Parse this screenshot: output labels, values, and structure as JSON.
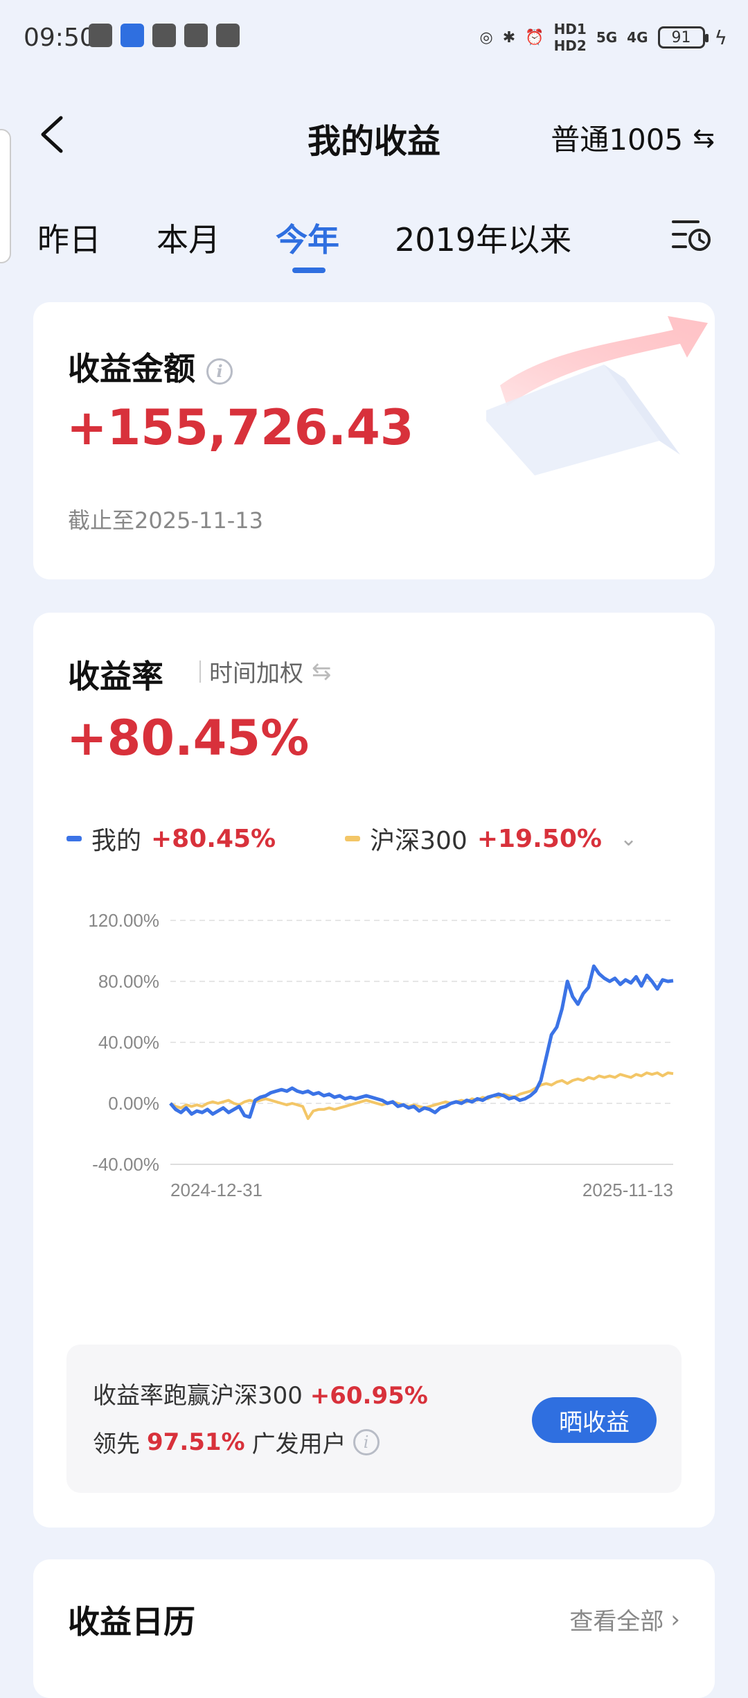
{
  "status_bar": {
    "time": "09:50",
    "hd1": "HD1",
    "hd2": "HD2",
    "net1": "5G",
    "net2": "4G",
    "battery": "91"
  },
  "header": {
    "title": "我的收益",
    "account": "普通1005"
  },
  "tabs": [
    "昨日",
    "本月",
    "今年",
    "2019年以来"
  ],
  "active_tab": "今年",
  "amount_card": {
    "title": "收益金额",
    "value": "+155,726.43",
    "as_of": "截止至2025-11-13"
  },
  "rate_card": {
    "title": "收益率",
    "mode": "时间加权",
    "value": "+80.45%",
    "legend": [
      {
        "name": "我的",
        "value": "+80.45%",
        "color": "#3b73e6"
      },
      {
        "name": "沪深300",
        "value": "+19.50%",
        "color": "#f3c667"
      }
    ]
  },
  "chart_data": {
    "type": "line",
    "y_ticks": [
      "120.00%",
      "80.00%",
      "40.00%",
      "0.00%",
      "-40.00%"
    ],
    "ylim": [
      -40,
      120
    ],
    "x_start_label": "2024-12-31",
    "x_end_label": "2025-11-13",
    "series": [
      {
        "name": "我的",
        "color": "#3b73e6",
        "values": [
          0,
          -4,
          -6,
          -3,
          -7,
          -5,
          -6,
          -4,
          -7,
          -5,
          -3,
          -6,
          -4,
          -2,
          -8,
          -9,
          2,
          4,
          5,
          7,
          8,
          9,
          8,
          10,
          8,
          7,
          8,
          6,
          7,
          5,
          6,
          4,
          5,
          3,
          4,
          3,
          4,
          5,
          4,
          3,
          2,
          0,
          1,
          -2,
          -1,
          -3,
          -2,
          -5,
          -3,
          -4,
          -6,
          -3,
          -2,
          0,
          1,
          0,
          2,
          1,
          3,
          2,
          4,
          5,
          6,
          5,
          3,
          4,
          2,
          3,
          5,
          8,
          15,
          30,
          45,
          50,
          62,
          80,
          70,
          65,
          72,
          76,
          90,
          85,
          82,
          80,
          82,
          78,
          81,
          79,
          83,
          77,
          84,
          80,
          75,
          81,
          80,
          80.45
        ]
      },
      {
        "name": "沪深300",
        "color": "#f3c667",
        "values": [
          0,
          -2,
          -3,
          -1,
          -2,
          -1,
          -2,
          0,
          1,
          0,
          1,
          2,
          0,
          -1,
          1,
          2,
          1,
          2,
          3,
          2,
          1,
          0,
          -1,
          0,
          -1,
          -2,
          -10,
          -5,
          -4,
          -4,
          -3,
          -4,
          -3,
          -2,
          -1,
          0,
          1,
          2,
          1,
          0,
          -1,
          0,
          1,
          0,
          -1,
          -2,
          -1,
          -2,
          -3,
          -2,
          -1,
          0,
          1,
          0,
          1,
          2,
          1,
          3,
          2,
          4,
          3,
          5,
          4,
          6,
          5,
          4,
          6,
          7,
          8,
          10,
          12,
          13,
          12,
          14,
          15,
          13,
          15,
          16,
          15,
          17,
          16,
          18,
          17,
          18,
          17,
          19,
          18,
          17,
          19,
          18,
          20,
          19,
          20,
          18,
          20,
          19.5
        ]
      }
    ]
  },
  "beat_box": {
    "line1_prefix": "收益率跑赢沪深300",
    "line1_value": "+60.95%",
    "line2_prefix": "领先",
    "line2_value": "97.51%",
    "line2_suffix": "广发用户",
    "button": "晒收益"
  },
  "calendar_card": {
    "title": "收益日历",
    "see_all": "查看全部"
  }
}
